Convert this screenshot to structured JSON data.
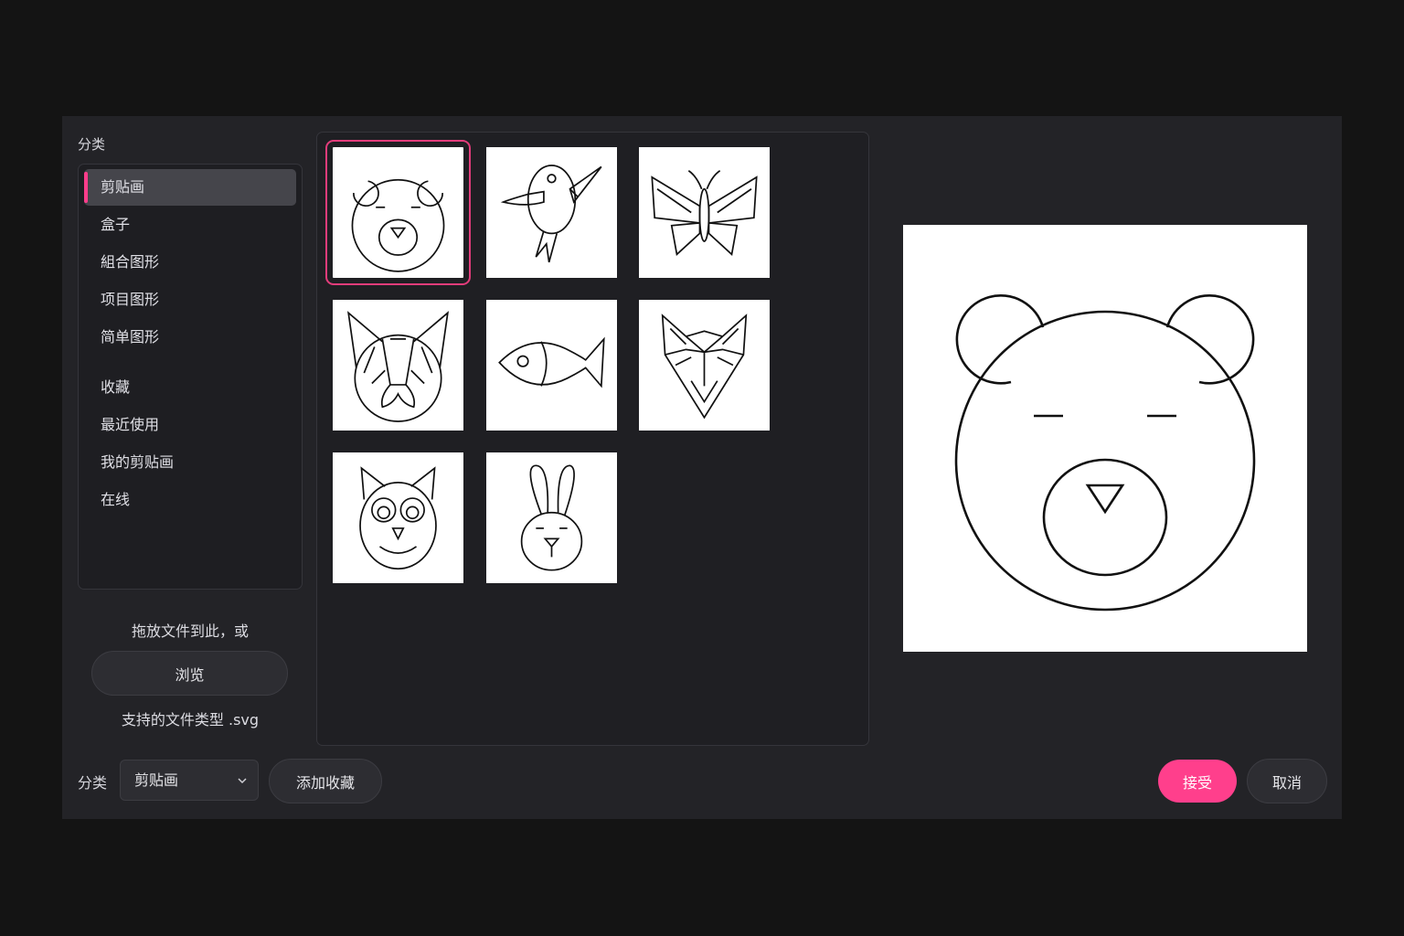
{
  "sidebar": {
    "heading": "分类",
    "items": [
      {
        "label": "剪贴画",
        "active": true
      },
      {
        "label": "盒子"
      },
      {
        "label": "組合图形"
      },
      {
        "label": "项目图形"
      },
      {
        "label": "简单图形"
      },
      {
        "label": "收藏"
      },
      {
        "label": "最近使用"
      },
      {
        "label": "我的剪贴画"
      },
      {
        "label": "在线"
      }
    ],
    "drop_text": "拖放文件到此，或",
    "browse_label": "浏览",
    "file_types": "支持的文件类型 .svg"
  },
  "gallery": {
    "items": [
      {
        "icon": "bear-icon",
        "selected": true
      },
      {
        "icon": "bird-icon"
      },
      {
        "icon": "butterfly-icon"
      },
      {
        "icon": "cat-icon"
      },
      {
        "icon": "fish-icon"
      },
      {
        "icon": "fox-icon"
      },
      {
        "icon": "owl-icon"
      },
      {
        "icon": "rabbit-icon"
      }
    ]
  },
  "preview": {
    "icon": "bear-icon"
  },
  "footer": {
    "category_label": "分类",
    "category_value": "剪贴画",
    "add_favorite_label": "添加收藏",
    "accept_label": "接受",
    "cancel_label": "取消"
  },
  "colors": {
    "accent": "#ff3f8c",
    "dialog_bg": "#232327",
    "page_bg": "#141414"
  }
}
